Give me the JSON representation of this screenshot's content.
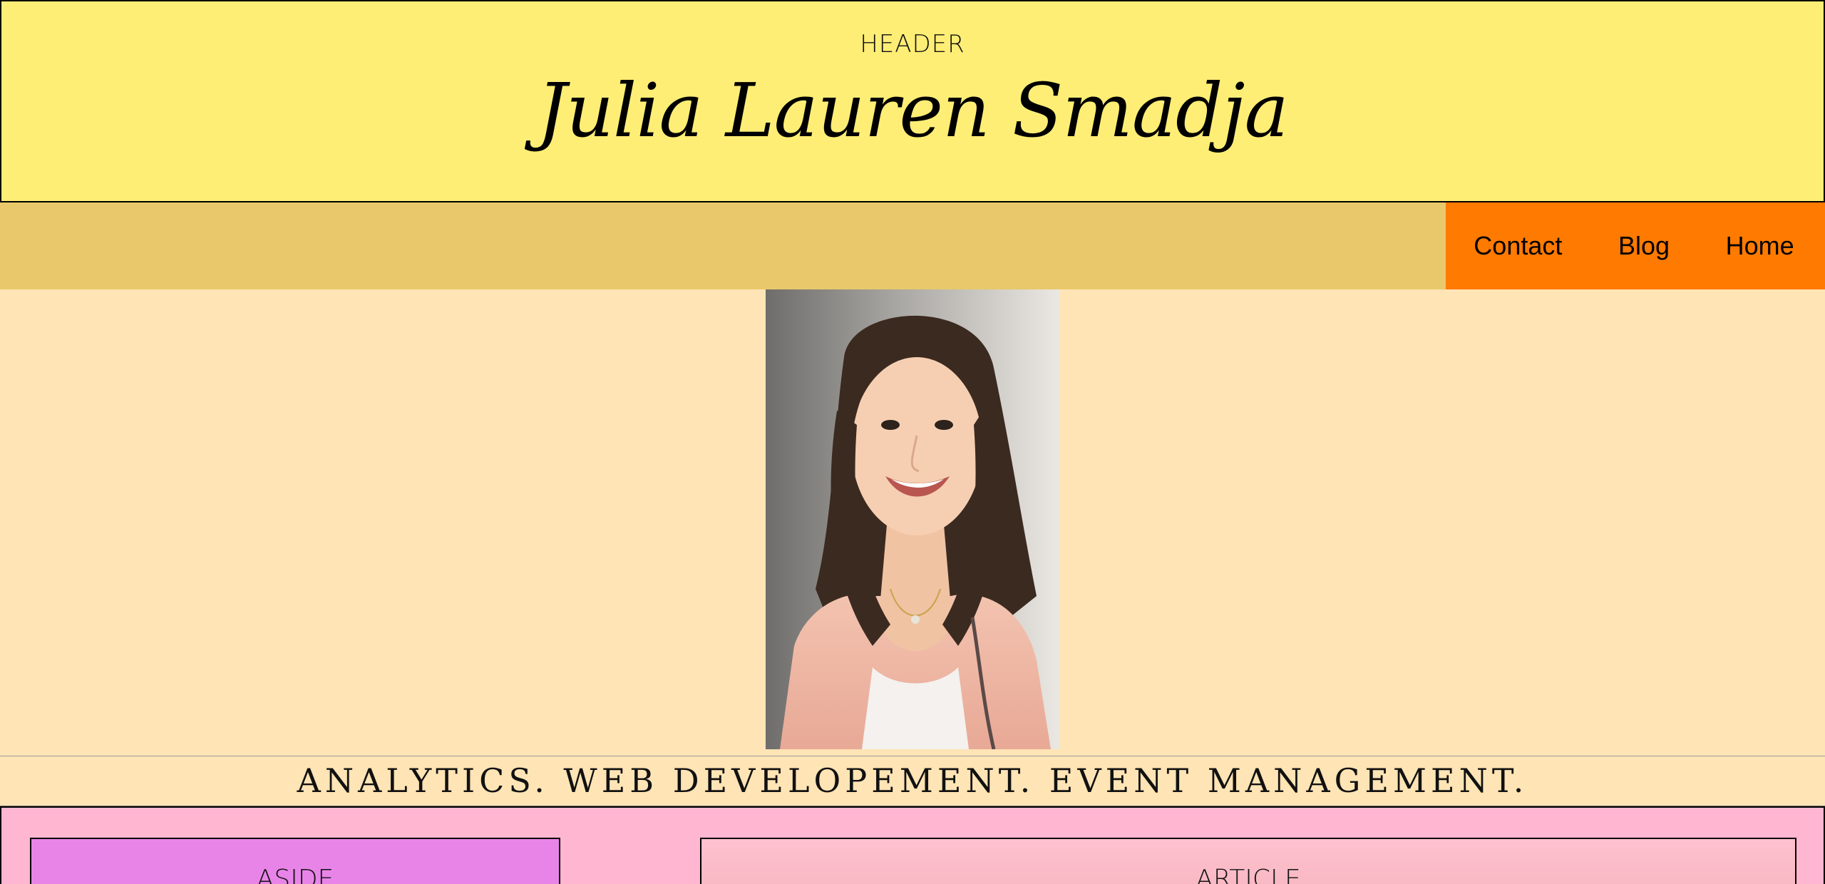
{
  "header": {
    "label": "HEADER",
    "name": "Julia Lauren Smadja"
  },
  "nav": {
    "items": [
      {
        "label": "Contact"
      },
      {
        "label": "Blog"
      },
      {
        "label": "Home"
      }
    ]
  },
  "tagline": "ANALYTICS. WEB DEVELOPEMENT. EVENT MANAGEMENT.",
  "content": {
    "aside_label": "ASIDE",
    "article_label": "ARTICLE"
  },
  "colors": {
    "header_bg": "#ffee75",
    "nav_bg": "#e8c86a",
    "nav_menu_bg": "#ff7a00",
    "page_bg": "#ffe4b5",
    "main_bg": "#ffb6d0",
    "aside_bg": "#e884e8"
  }
}
